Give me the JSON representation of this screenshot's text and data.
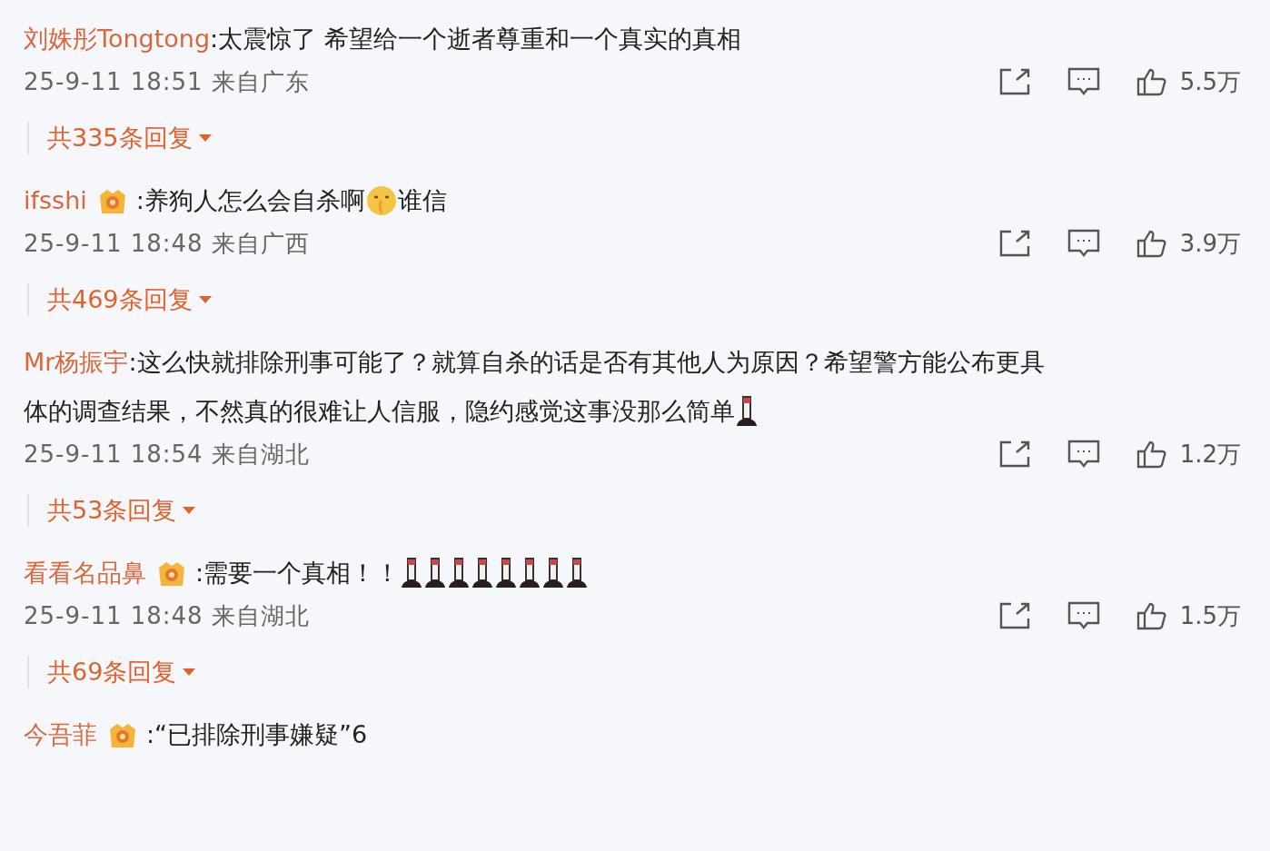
{
  "comments": [
    {
      "user": "刘姝彤Tongtong",
      "badge": false,
      "parts": [
        {
          "kind": "text",
          "text": ":太震惊了 希望给一个逝者尊重和一个真实的真相"
        }
      ],
      "time": "25-9-11 18:51 来自广东",
      "likes": "5.5万",
      "replies": "共335条回复"
    },
    {
      "user": "ifsshi",
      "badge": true,
      "parts": [
        {
          "kind": "text",
          "text": ":养狗人怎么会自杀啊"
        },
        {
          "kind": "face"
        },
        {
          "kind": "text",
          "text": "谁信"
        }
      ],
      "time": "25-9-11 18:48 来自广西",
      "likes": "3.9万",
      "replies": "共469条回复"
    },
    {
      "user": "Mr杨振宇",
      "badge": false,
      "parts": [
        {
          "kind": "text",
          "text": ":这么快就排除刑事可能了？就算自杀的话是否有其他人为原因？希望警方能公布更具"
        },
        {
          "kind": "text",
          "text": "体的调查结果，不然真的很难让人信服，隐约感觉这事没那么简单"
        },
        {
          "kind": "candle"
        }
      ],
      "time": "25-9-11 18:54 来自湖北",
      "likes": "1.2万",
      "replies": "共53条回复"
    },
    {
      "user": "看看名品鼻",
      "badge": true,
      "parts": [
        {
          "kind": "text",
          "text": ":需要一个真相！！"
        },
        {
          "kind": "candle"
        },
        {
          "kind": "candle"
        },
        {
          "kind": "candle"
        },
        {
          "kind": "candle"
        },
        {
          "kind": "candle"
        },
        {
          "kind": "candle"
        },
        {
          "kind": "candle"
        },
        {
          "kind": "candle"
        }
      ],
      "time": "25-9-11 18:48 来自湖北",
      "likes": "1.5万",
      "replies": "共69条回复"
    },
    {
      "user": "今吾菲",
      "badge": true,
      "parts": [
        {
          "kind": "text",
          "text": ":“已排除刑事嫌疑”6"
        }
      ]
    }
  ]
}
